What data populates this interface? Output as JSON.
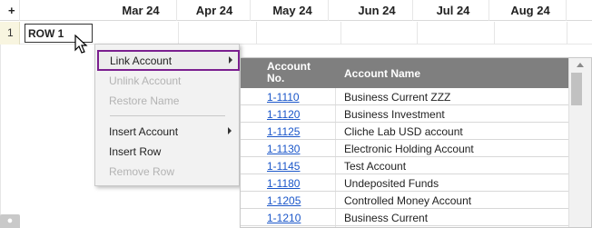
{
  "grid": {
    "corner_label": "+",
    "months": [
      "Mar 24",
      "Apr 24",
      "May 24",
      "Jun 24",
      "Jul 24",
      "Aug 24"
    ],
    "row": {
      "number": "1",
      "name": "ROW 1"
    }
  },
  "context_menu": {
    "items": [
      {
        "label": "Link Account",
        "state": "active",
        "submenu": true
      },
      {
        "label": "Unlink Account",
        "state": "disabled",
        "submenu": false
      },
      {
        "label": "Restore Name",
        "state": "disabled",
        "submenu": false
      },
      {
        "label": "Insert Account",
        "state": "enabled",
        "submenu": true
      },
      {
        "label": "Insert Row",
        "state": "enabled",
        "submenu": false
      },
      {
        "label": "Remove Row",
        "state": "disabled",
        "submenu": false
      }
    ]
  },
  "accounts": {
    "header_no": "Account No.",
    "header_name": "Account Name",
    "rows": [
      {
        "no": "1-1110",
        "name": "Business Current ZZZ"
      },
      {
        "no": "1-1120",
        "name": "Business Investment"
      },
      {
        "no": "1-1125",
        "name": "Cliche Lab USD account"
      },
      {
        "no": "1-1130",
        "name": "Electronic Holding Account"
      },
      {
        "no": "1-1145",
        "name": "Test Account"
      },
      {
        "no": "1-1180",
        "name": "Undeposited Funds"
      },
      {
        "no": "1-1205",
        "name": "Controlled Money Account"
      },
      {
        "no": "1-1210",
        "name": "Business Current"
      }
    ]
  },
  "colors": {
    "active_border": "#7b1f8f",
    "header_bg": "#7f7f7f",
    "link": "#1a56c9",
    "row_number_bg": "#f8f5e0"
  }
}
